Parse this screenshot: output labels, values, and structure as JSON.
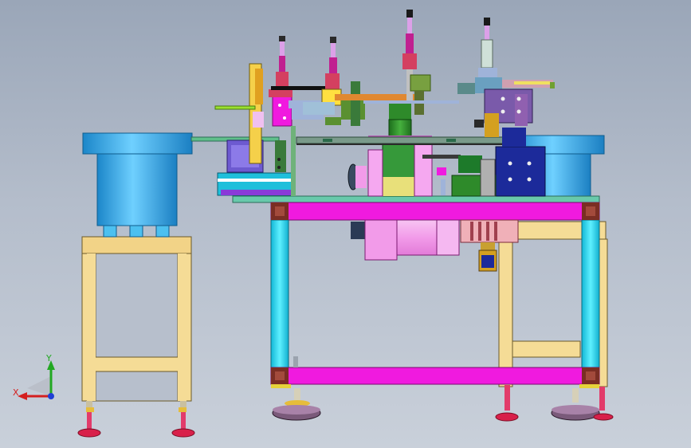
{
  "viewport": {
    "background_top": "#9aa6b8",
    "background_bottom": "#c9d0da"
  },
  "axis_triad": {
    "x_label": "X",
    "y_label": "Y",
    "x_color": "#d41f1f",
    "y_color": "#22a822",
    "z_color": "#1f3fd4"
  },
  "colors": {
    "bowl_blue": "#2fa6e8",
    "stand_yellow": "#f5dc96",
    "frame_magenta": "#f01adf",
    "frame_cyan": "#1fd9f2",
    "frame_corner": "#7a2e24",
    "foot_red": "#d8204a",
    "pink_motor": "#f5a8f0",
    "green_block": "#2e8a2a",
    "navy_block": "#1c2a9a",
    "purple_part": "#6d5ad0"
  }
}
